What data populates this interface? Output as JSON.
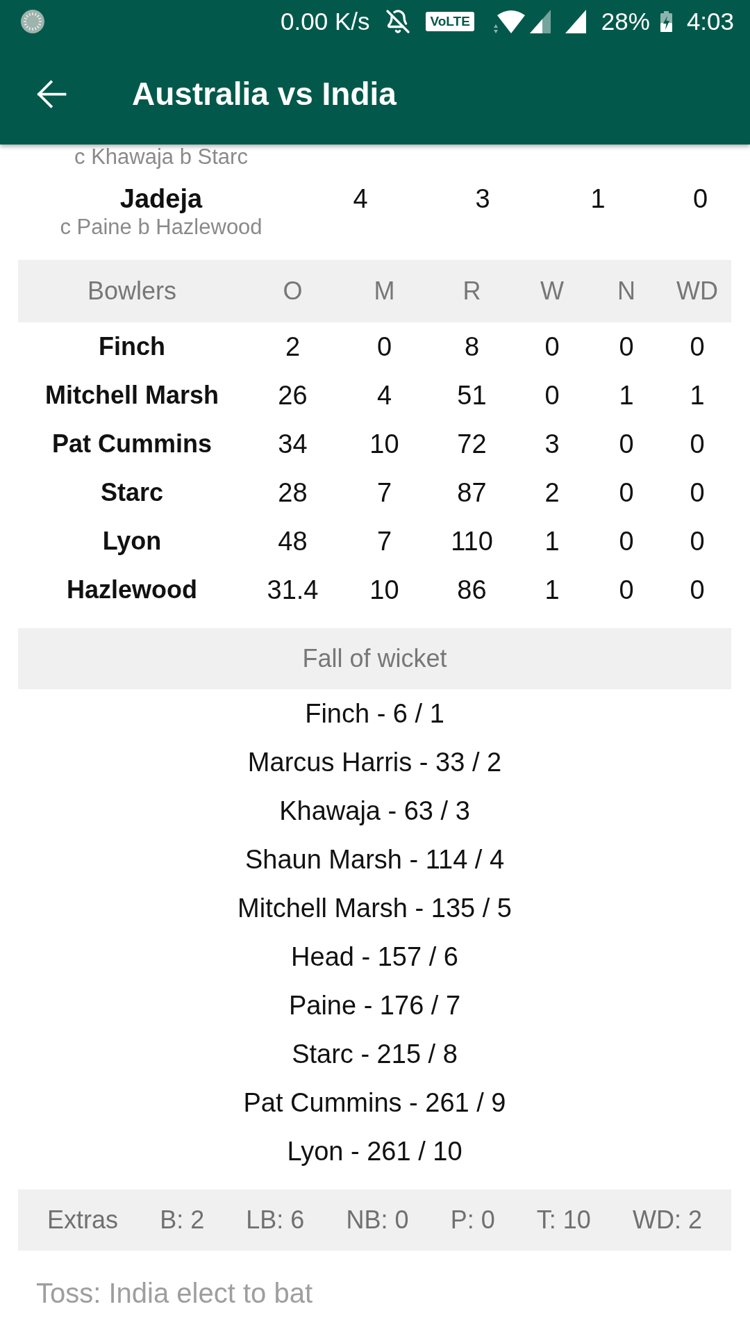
{
  "status_bar": {
    "speed": "0.00 K/s",
    "network_badge": "VoLTE",
    "battery": "28%",
    "time": "4:03"
  },
  "app_bar": {
    "title": "Australia vs India"
  },
  "batting": {
    "rows": [
      {
        "dismissal": "c Khawaja b Starc"
      },
      {
        "name": "Jadeja",
        "dismissal": "c Paine b Hazlewood",
        "values": [
          "4",
          "3",
          "1",
          "0"
        ]
      }
    ]
  },
  "bowling": {
    "columns": [
      "Bowlers",
      "O",
      "M",
      "R",
      "W",
      "N",
      "WD"
    ],
    "rows": [
      {
        "name": "Finch",
        "values": [
          "2",
          "0",
          "8",
          "0",
          "0",
          "0"
        ]
      },
      {
        "name": "Mitchell Marsh",
        "values": [
          "26",
          "4",
          "51",
          "0",
          "1",
          "1"
        ]
      },
      {
        "name": "Pat Cummins",
        "values": [
          "34",
          "10",
          "72",
          "3",
          "0",
          "0"
        ]
      },
      {
        "name": "Starc",
        "values": [
          "28",
          "7",
          "87",
          "2",
          "0",
          "0"
        ]
      },
      {
        "name": "Lyon",
        "values": [
          "48",
          "7",
          "110",
          "1",
          "0",
          "0"
        ]
      },
      {
        "name": "Hazlewood",
        "values": [
          "31.4",
          "10",
          "86",
          "1",
          "0",
          "0"
        ]
      }
    ]
  },
  "fall_of_wicket": {
    "title": "Fall of wicket",
    "entries": [
      "Finch - 6 / 1",
      "Marcus Harris - 33 / 2",
      "Khawaja - 63 / 3",
      "Shaun Marsh - 114 / 4",
      "Mitchell Marsh - 135 / 5",
      "Head - 157 / 6",
      "Paine - 176 / 7",
      "Starc - 215 / 8",
      "Pat Cummins - 261 / 9",
      "Lyon - 261 / 10"
    ]
  },
  "extras": {
    "label": "Extras",
    "items": [
      "B: 2",
      "LB: 6",
      "NB: 0",
      "P: 0",
      "T: 10",
      "WD: 2"
    ]
  },
  "toss": "Toss: India elect to bat"
}
